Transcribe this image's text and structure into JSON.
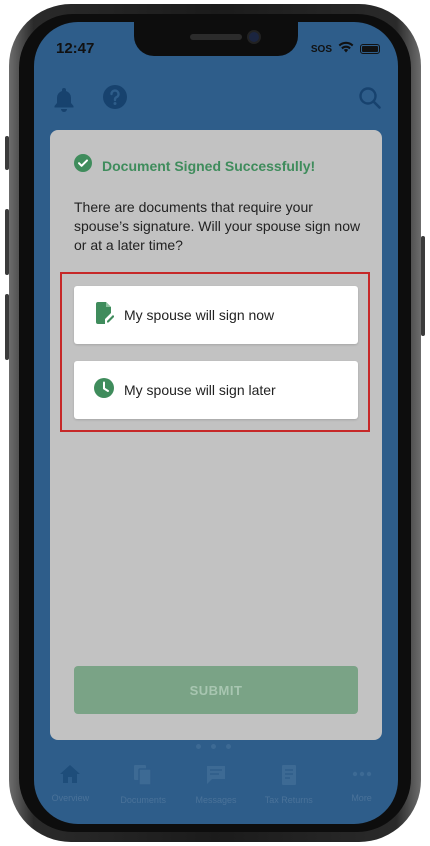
{
  "status_bar": {
    "time": "12:47",
    "sos": "SOS"
  },
  "header": {
    "bell_icon": "bell-icon",
    "help_icon": "help-icon",
    "search_icon": "search-icon"
  },
  "dialog": {
    "success_icon": "check-circle-icon",
    "success_message": "Document Signed Successfully!",
    "prompt": "There are documents that require your spouse’s signature. Will your spouse sign now or at a later time?",
    "options": [
      {
        "label": "My spouse will sign now",
        "icon": "document-edit-icon"
      },
      {
        "label": "My spouse will sign later",
        "icon": "clock-icon"
      }
    ],
    "submit_label": "SUBMIT"
  },
  "tabbar": {
    "tabs": [
      {
        "label": "Overview",
        "icon": "home-icon"
      },
      {
        "label": "Documents",
        "icon": "documents-icon"
      },
      {
        "label": "Messages",
        "icon": "message-icon"
      },
      {
        "label": "Tax Returns",
        "icon": "tax-return-icon"
      },
      {
        "label": "More",
        "icon": "more-icon"
      }
    ]
  },
  "colors": {
    "accent_green": "#3f8c5c",
    "highlight_red": "#c62828",
    "app_blue": "#2e5d8a",
    "overlay_gray": "#c2c2c2"
  }
}
